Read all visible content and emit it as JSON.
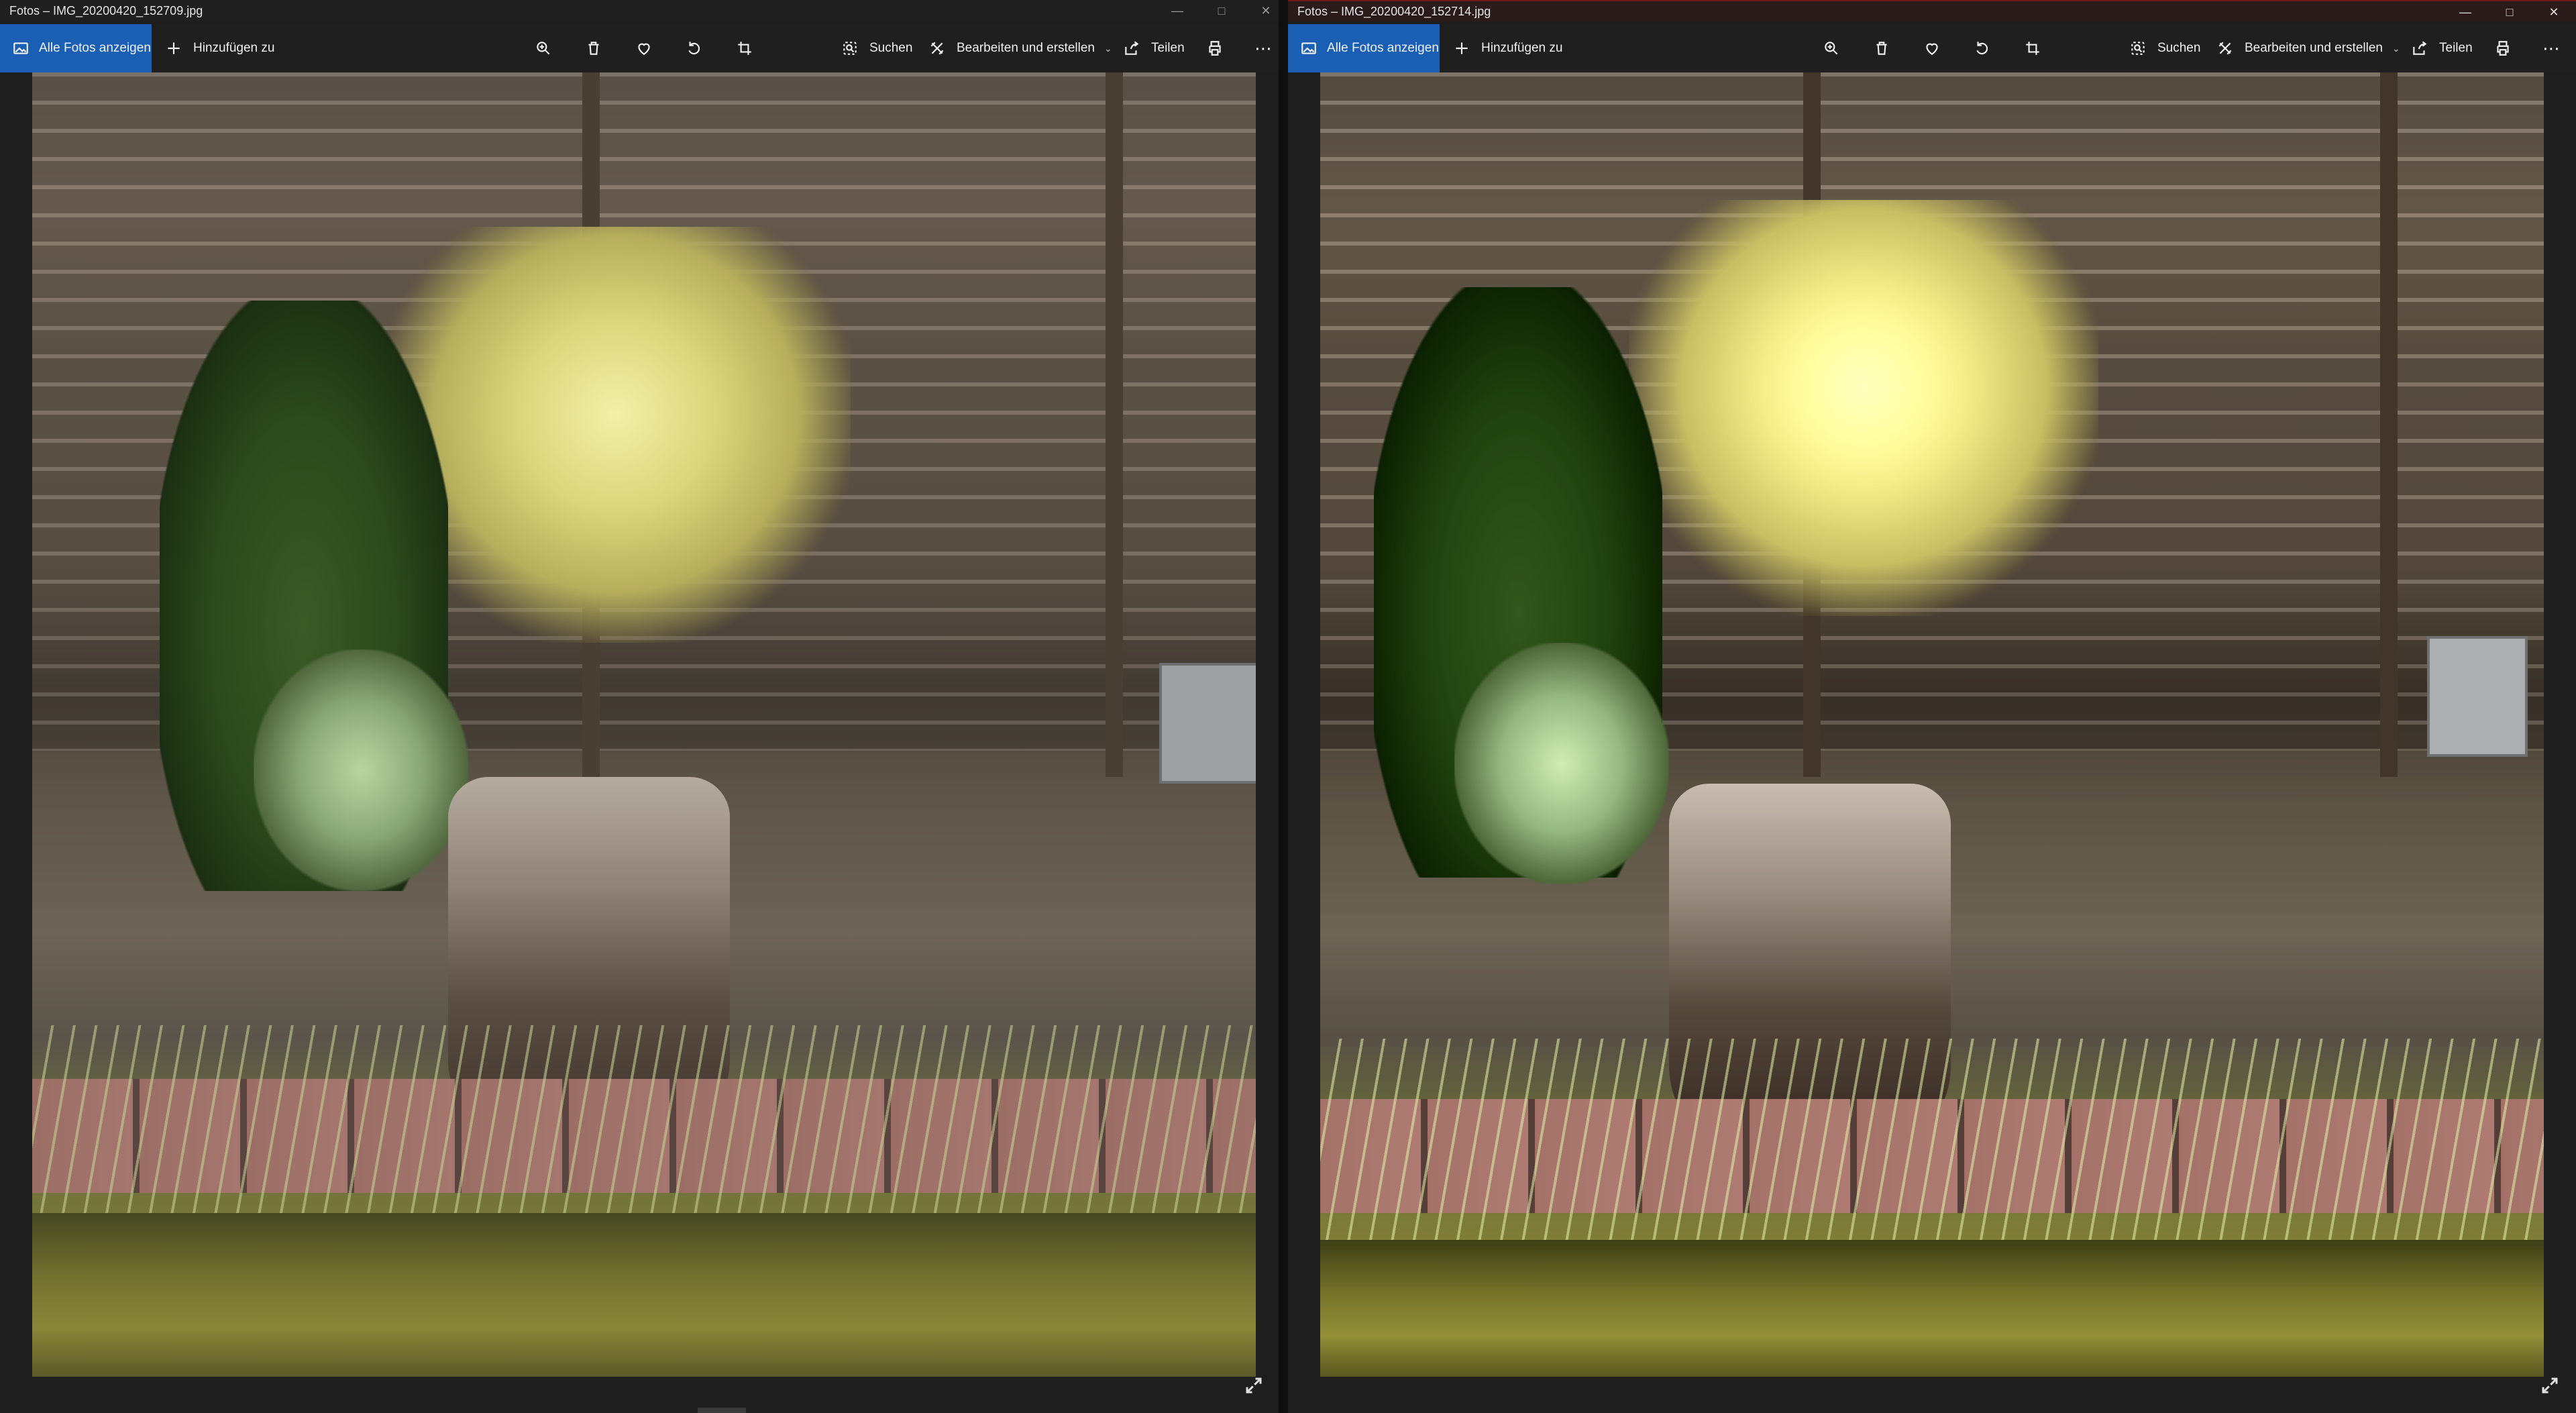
{
  "windows": [
    {
      "title": "Fotos – IMG_20200420_152709.jpg",
      "toolbar": {
        "show_all": "Alle Fotos anzeigen",
        "add_to": "Hinzufügen zu",
        "search": "Suchen",
        "edit_create": "Bearbeiten und erstellen",
        "share": "Teilen"
      }
    },
    {
      "title": "Fotos – IMG_20200420_152714.jpg",
      "toolbar": {
        "show_all": "Alle Fotos anzeigen",
        "add_to": "Hinzufügen zu",
        "search": "Suchen",
        "edit_create": "Bearbeiten und erstellen",
        "share": "Teilen"
      }
    }
  ],
  "icons": {
    "photos_app": "photos-icon",
    "add": "plus-icon",
    "zoom": "zoom-in-icon",
    "delete": "trash-icon",
    "favorite": "heart-icon",
    "rotate": "rotate-icon",
    "crop": "crop-icon",
    "search": "search-icon",
    "edit": "edit-create-icon",
    "share": "share-icon",
    "print": "print-icon",
    "more": "more-icon",
    "expand": "expand-icon"
  },
  "colors": {
    "accent": "#1a5fb4",
    "toolbar_bg": "#1f1f1f",
    "text": "#f0f0f0"
  }
}
